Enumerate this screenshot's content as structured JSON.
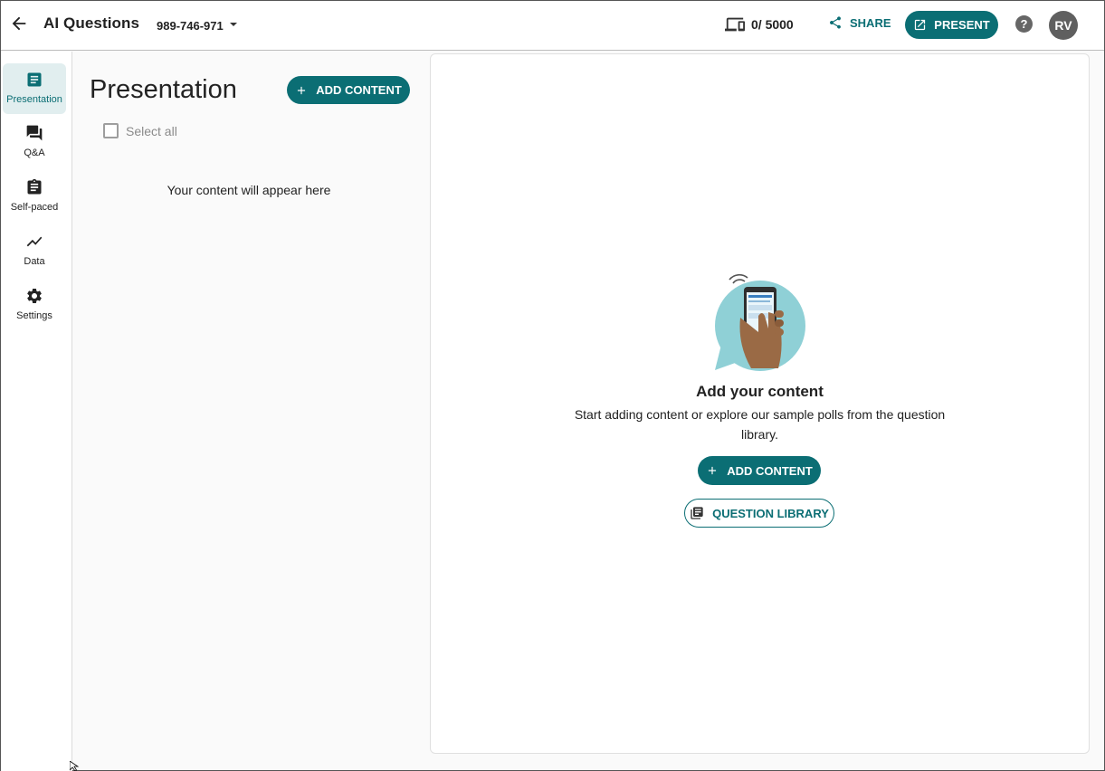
{
  "header": {
    "title": "AI Questions",
    "event_code": "989-746-971",
    "participant_count": "0/ 5000",
    "share_label": "SHARE",
    "present_label": "PRESENT",
    "help_label": "?",
    "avatar_initials": "RV"
  },
  "sidebar": {
    "items": [
      {
        "label": "Presentation",
        "icon": "presentation-icon",
        "active": true
      },
      {
        "label": "Q&A",
        "icon": "qa-chat-icon",
        "active": false
      },
      {
        "label": "Self-paced",
        "icon": "clipboard-icon",
        "active": false
      },
      {
        "label": "Data",
        "icon": "chart-line-icon",
        "active": false
      },
      {
        "label": "Settings",
        "icon": "gear-icon",
        "active": false
      }
    ]
  },
  "panel": {
    "title": "Presentation",
    "add_content_label": "ADD CONTENT",
    "select_all_label": "Select all",
    "empty_text": "Your content will appear here"
  },
  "main": {
    "empty_title": "Add your content",
    "empty_description": "Start adding content or explore our sample polls from the question library.",
    "add_content_label": "ADD CONTENT",
    "question_library_label": "QUESTION LIBRARY"
  },
  "colors": {
    "accent": "#0b6e74",
    "active_nav_bg": "#e1eeef",
    "avatar_bg": "#5f5f5f"
  }
}
